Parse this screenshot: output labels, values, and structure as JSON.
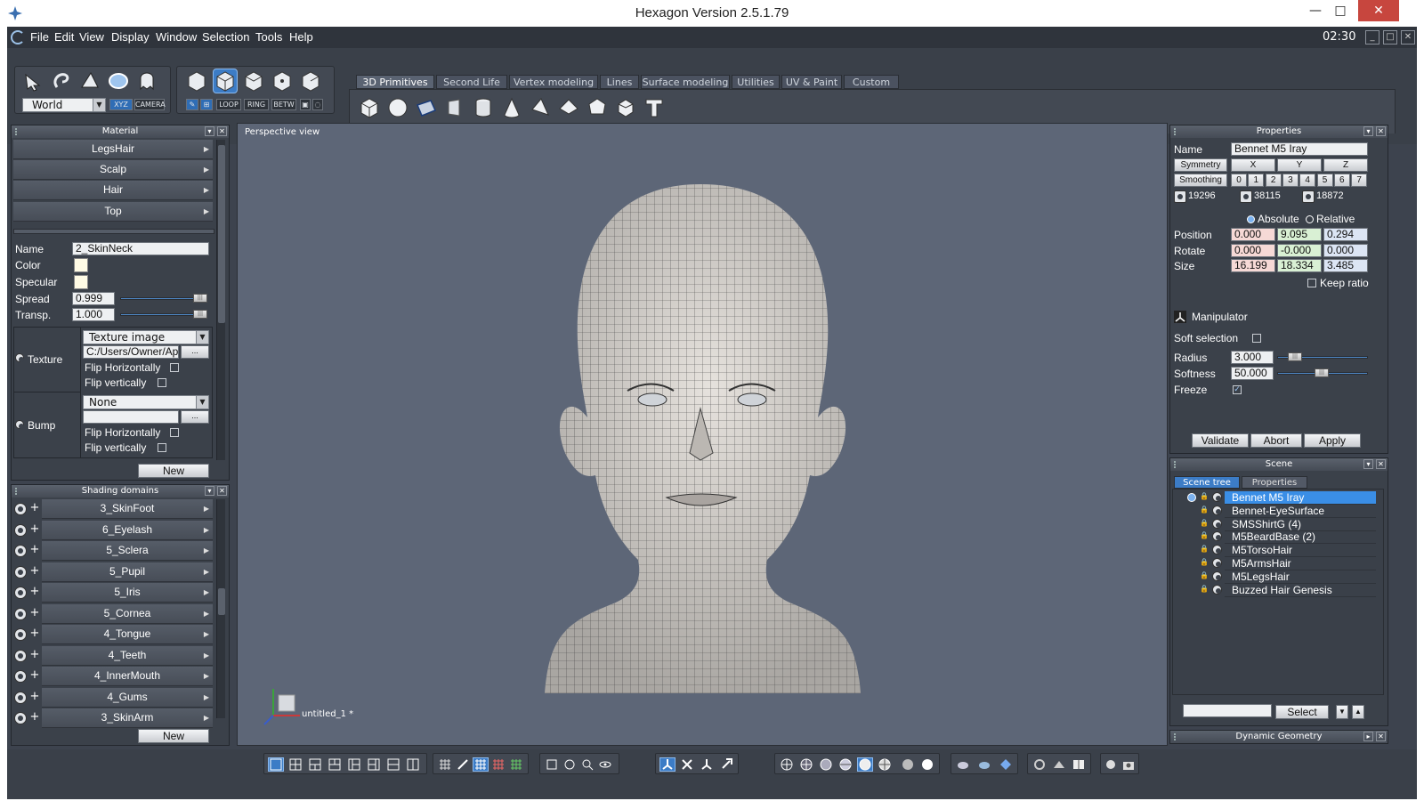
{
  "window": {
    "title": "Hexagon Version 2.5.1.79",
    "min": "—",
    "max": "□",
    "close": "✕"
  },
  "menu": {
    "items": [
      "File",
      "Edit",
      "View",
      "Display",
      "Window",
      "Selection",
      "Tools",
      "Help"
    ],
    "clock": "02:30",
    "controls": [
      "_",
      "□",
      "✕"
    ]
  },
  "toolbar": {
    "coord_select": "World",
    "xyz_label": "XYZ",
    "camera_label": "CAMERA",
    "loop_label": "LOOP",
    "ring_label": "RING",
    "betw_label": "BETW",
    "tabs": [
      "3D Primitives",
      "Second Life",
      "Vertex modeling",
      "Lines",
      "Surface modeling",
      "Utilities",
      "UV & Paint",
      "Custom"
    ],
    "active_tab": "3D Primitives",
    "primitives": [
      "cube-icon",
      "sphere-icon",
      "plane-icon",
      "box-panel-icon",
      "cylinder-icon",
      "cone-icon",
      "pyramid-icon",
      "diamond-icon",
      "dodecahedron-icon",
      "polyhedron-icon",
      "text-icon"
    ]
  },
  "material_panel": {
    "title": "Material",
    "items": [
      "LegsHair",
      "Scalp",
      "Hair",
      "Top"
    ],
    "name_label": "Name",
    "name_value": "2_SkinNeck",
    "color_label": "Color",
    "specular_label": "Specular",
    "spread_label": "Spread",
    "spread_value": "0.999",
    "transp_label": "Transp.",
    "transp_value": "1.000",
    "spread_level": 0.999,
    "transp_level": 1.0,
    "texture_label": "Texture",
    "texture_type": "Texture image",
    "texture_path": "C:/Users/Owner/Ap",
    "browse_label": "...",
    "flip_h_label": "Flip Horizontally",
    "flip_v_label": "Flip vertically",
    "bump_label": "Bump",
    "bump_type": "None",
    "bump_path": "",
    "new_label": "New"
  },
  "shading_panel": {
    "title": "Shading domains",
    "items": [
      "3_SkinFoot",
      "6_Eyelash",
      "5_Sclera",
      "5_Pupil",
      "5_Iris",
      "5_Cornea",
      "4_Tongue",
      "4_Teeth",
      "4_InnerMouth",
      "4_Gums",
      "3_SkinArm"
    ],
    "new_label": "New"
  },
  "viewport": {
    "label": "Perspective view",
    "filename": "untitled_1 *"
  },
  "properties_panel": {
    "title": "Properties",
    "name_label": "Name",
    "name_value": "Bennet M5 Iray",
    "symmetry_label": "Symmetry",
    "symmetry_axes": [
      "X",
      "Y",
      "Z"
    ],
    "smoothing_label": "Smoothing",
    "smoothing_levels": [
      "0",
      "1",
      "2",
      "3",
      "4",
      "5",
      "6",
      "7"
    ],
    "counts": [
      "19296",
      "38115",
      "18872"
    ],
    "absolute_label": "Absolute",
    "relative_label": "Relative",
    "position_label": "Position",
    "position": [
      "0.000",
      "9.095",
      "0.294"
    ],
    "rotate_label": "Rotate",
    "rotate": [
      "0.000",
      "-0.000",
      "0.000"
    ],
    "size_label": "Size",
    "size": [
      "16.199",
      "18.334",
      "3.485"
    ],
    "keep_ratio_label": "Keep ratio",
    "manipulator_label": "Manipulator",
    "soft_selection_label": "Soft selection",
    "radius_label": "Radius",
    "radius_value": "3.000",
    "softness_label": "Softness",
    "softness_value": "50.000",
    "freeze_label": "Freeze",
    "validate_label": "Validate",
    "abort_label": "Abort",
    "apply_label": "Apply"
  },
  "scene_panel": {
    "title": "Scene",
    "tabs": [
      "Scene tree",
      "Properties"
    ],
    "items": [
      "Bennet M5 Iray",
      "Bennet-EyeSurface",
      "SMSShirtG (4)",
      "M5BeardBase (2)",
      "M5TorsoHair",
      "M5ArmsHair",
      "M5LegsHair",
      "Buzzed Hair Genesis"
    ],
    "selected": "Bennet M5 Iray",
    "select_label": "Select",
    "search_value": ""
  },
  "dynamic_panel": {
    "title": "Dynamic Geometry"
  },
  "colors": {
    "accent": "#3c7cc6",
    "background": "#3d434e",
    "viewport": "#5d6677",
    "selection": "#3a8ee6"
  }
}
